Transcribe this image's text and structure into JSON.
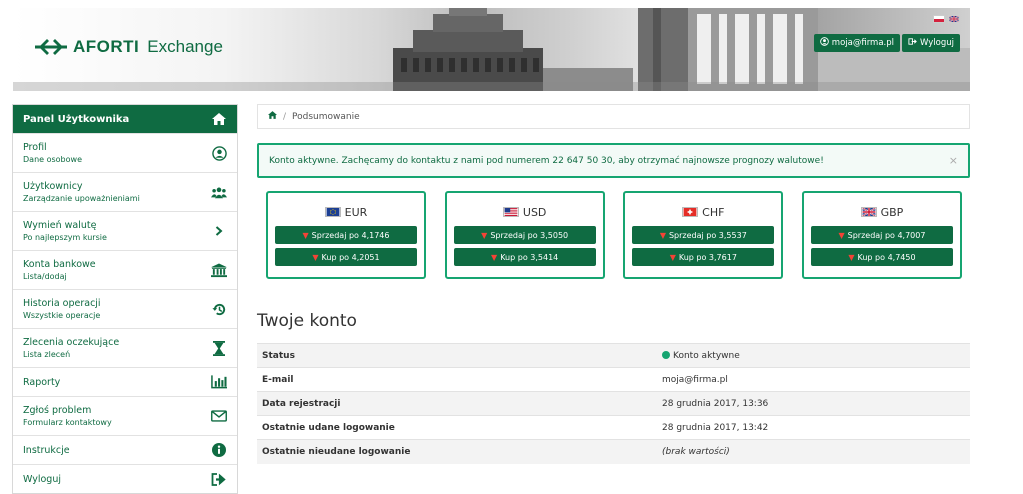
{
  "header": {
    "logo_brand": "AFORTI",
    "logo_product": "Exchange",
    "user_email": "moja@firma.pl",
    "logout_label": "Wyloguj"
  },
  "sidebar": {
    "title": "Panel Użytkownika",
    "items": [
      {
        "label": "Profil",
        "sub": "Dane osobowe",
        "icon": "user-icon"
      },
      {
        "label": "Użytkownicy",
        "sub": "Zarządzanie upoważnieniami",
        "icon": "users-icon"
      },
      {
        "label": "Wymień walutę",
        "sub": "Po najlepszym kursie",
        "icon": "chevron-right-icon"
      },
      {
        "label": "Konta bankowe",
        "sub": "Lista/dodaj",
        "icon": "bank-icon"
      },
      {
        "label": "Historia operacji",
        "sub": "Wszystkie operacje",
        "icon": "history-icon"
      },
      {
        "label": "Zlecenia oczekujące",
        "sub": "Lista zleceń",
        "icon": "hourglass-icon"
      },
      {
        "label": "Raporty",
        "sub": "",
        "icon": "bar-chart-icon"
      },
      {
        "label": "Zgłoś problem",
        "sub": "Formularz kontaktowy",
        "icon": "envelope-icon"
      },
      {
        "label": "Instrukcje",
        "sub": "",
        "icon": "info-icon"
      },
      {
        "label": "Wyloguj",
        "sub": "",
        "icon": "sign-out-icon"
      }
    ]
  },
  "breadcrumb": {
    "current": "Podsumowanie"
  },
  "alert": {
    "text": "Konto aktywne. Zachęcamy do kontaktu z nami pod numerem 22 647 50 30, aby otrzymać najnowsze prognozy walutowe!",
    "close": "×"
  },
  "rates": [
    {
      "code": "EUR",
      "sell": "Sprzedaj po 4,1746",
      "buy": "Kup po 4,2051"
    },
    {
      "code": "USD",
      "sell": "Sprzedaj po 3,5050",
      "buy": "Kup po 3,5414"
    },
    {
      "code": "CHF",
      "sell": "Sprzedaj po 3,5537",
      "buy": "Kup po 3,7617"
    },
    {
      "code": "GBP",
      "sell": "Sprzedaj po 4,7007",
      "buy": "Kup po 4,7450"
    }
  ],
  "account": {
    "title": "Twoje konto",
    "rows": [
      {
        "key": "Status",
        "value": "Konto aktywne"
      },
      {
        "key": "E-mail",
        "value": "moja@firma.pl"
      },
      {
        "key": "Data rejestracji",
        "value": "28 grudnia 2017, 13:36"
      },
      {
        "key": "Ostatnie udane logowanie",
        "value": "28 grudnia 2017, 13:42"
      },
      {
        "key": "Ostatnie nieudane logowanie",
        "value": "(brak wartości)"
      }
    ]
  },
  "colors": {
    "brand": "#0f6b42",
    "accent": "#16a571",
    "arrow": "#f44336"
  }
}
